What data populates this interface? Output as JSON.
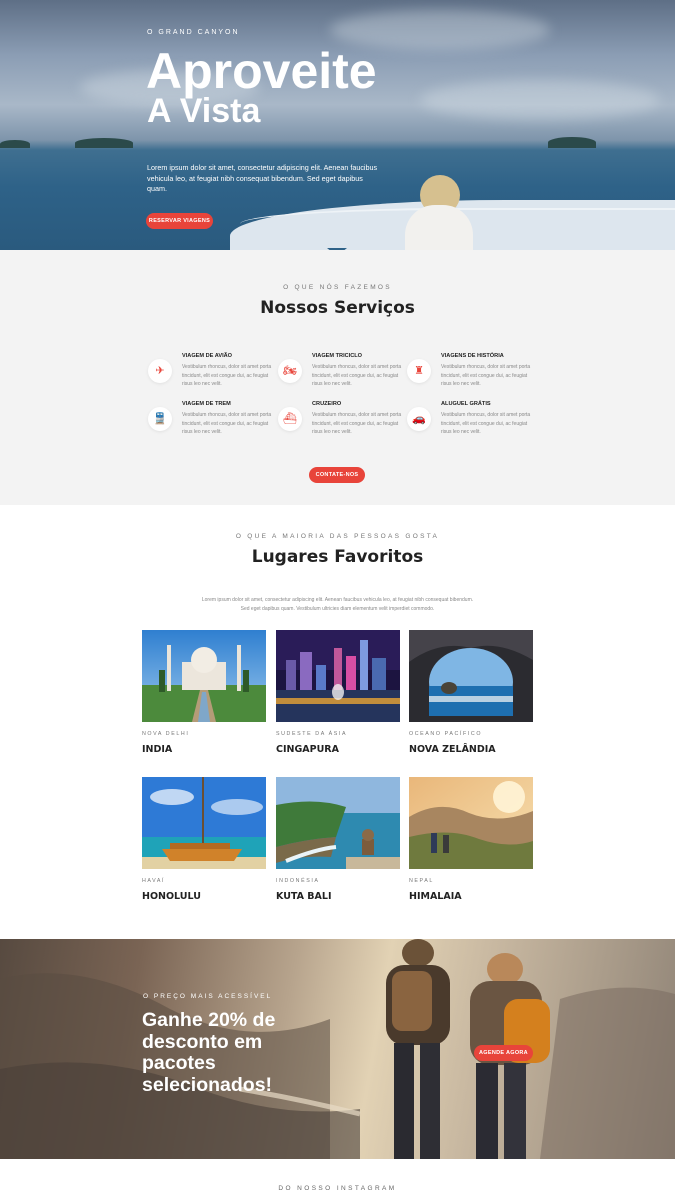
{
  "hero": {
    "eyebrow": "O GRAND CANYON",
    "title_line1": "Aproveite",
    "title_line2": "A Vista",
    "lead": "Lorem ipsum dolor sit amet, consectetur adipiscing elit. Aenean faucibus vehicula leo, at feugiat nibh consequat bibendum. Sed eget dapibus quam.",
    "button_label": "RESERVAR VIAGENS"
  },
  "services": {
    "eyebrow": "O QUE NÓS FAZEMOS",
    "title": "Nossos Serviços",
    "items": [
      {
        "icon": "plane-icon",
        "glyph": "✈",
        "title": "VIAGEM DE AVIÃO",
        "text": "Vestibulum rhoncus, dolor sit amet porta tincidunt, elit est congue dui, ac feugiat risus leo nec velit."
      },
      {
        "icon": "motorcycle-icon",
        "glyph": "🏍",
        "title": "VIAGEM TRICICLO",
        "text": "Vestibulum rhoncus, dolor sit amet porta tincidunt, elit est congue dui, ac feugiat risus leo nec velit."
      },
      {
        "icon": "castle-icon",
        "glyph": "♜",
        "title": "VIAGENS DE HISTÓRIA",
        "text": "Vestibulum rhoncus, dolor sit amet porta tincidunt, elit est congue dui, ac feugiat risus leo nec velit."
      },
      {
        "icon": "train-icon",
        "glyph": "🚆",
        "title": "VIAGEM DE TREM",
        "text": "Vestibulum rhoncus, dolor sit amet porta tincidunt, elit est congue dui, ac feugiat risus leo nec velit."
      },
      {
        "icon": "ship-icon",
        "glyph": "⛴",
        "title": "CRUZEIRO",
        "text": "Vestibulum rhoncus, dolor sit amet porta tincidunt, elit est congue dui, ac feugiat risus leo nec velit."
      },
      {
        "icon": "car-icon",
        "glyph": "🚗",
        "title": "ALUGUEL GRÁTIS",
        "text": "Vestibulum rhoncus, dolor sit amet porta tincidunt, elit est congue dui, ac feugiat risus leo nec velit."
      }
    ],
    "button_label": "CONTATE-NOS"
  },
  "places": {
    "eyebrow": "O QUE A MAIORIA DAS PESSOAS GOSTA",
    "title": "Lugares Favoritos",
    "intro": "Lorem ipsum dolor sit amet, consectetur adipiscing elit. Aenean faucibus vehicula leo, at feugiat nibh consequat bibendum. Sed eget dapibus quam. Vestibulum ultricies diam elementum velit imperdiet commodo.",
    "cards": [
      {
        "region": "NOVA DELHI",
        "name": "INDIA"
      },
      {
        "region": "SUDESTE DA ÁSIA",
        "name": "CINGAPURA"
      },
      {
        "region": "OCEANO PACÍFICO",
        "name": "NOVA ZELÂNDIA"
      },
      {
        "region": "HAVAÍ",
        "name": "HONOLULU"
      },
      {
        "region": "INDONÉSIA",
        "name": "KUTA BALI"
      },
      {
        "region": "NEPAL",
        "name": "HIMALAIA"
      }
    ]
  },
  "promo": {
    "eyebrow": "O PREÇO MAIS ACESSÍVEL",
    "headline": "Ganhe 20% de desconto em pacotes selecionados!",
    "button_label": "AGENDE AGORA"
  },
  "instagram": {
    "eyebrow": "DO NOSSO INSTAGRAM"
  },
  "colors": {
    "accent": "#e8443a",
    "services_bg": "#f3f3f3"
  }
}
